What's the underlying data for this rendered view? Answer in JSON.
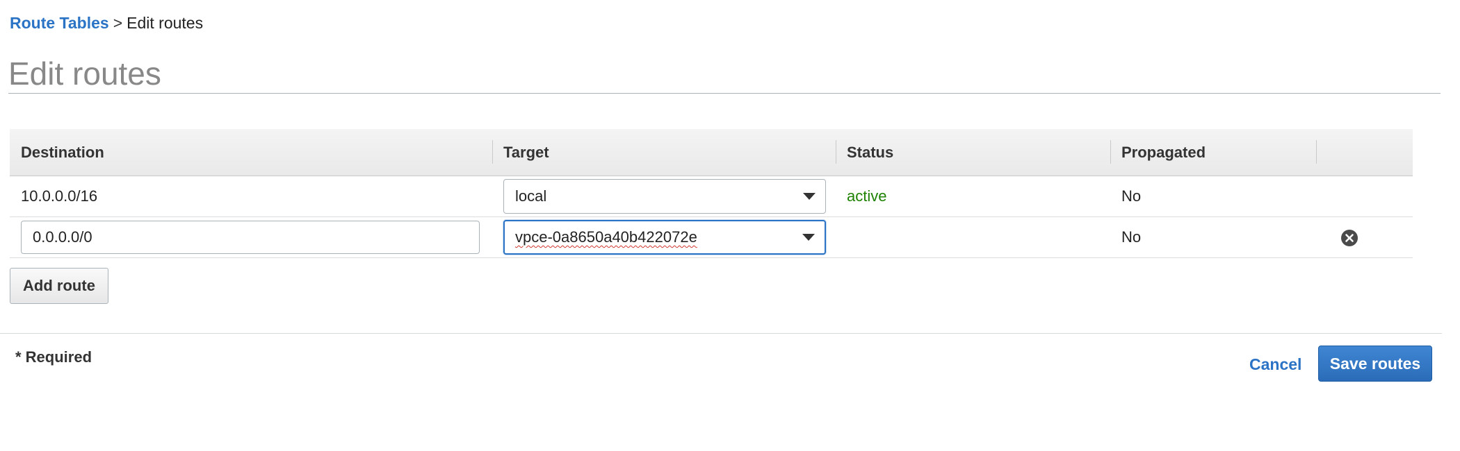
{
  "breadcrumb": {
    "parent": "Route Tables",
    "separator": ">",
    "current": "Edit routes"
  },
  "page_title": "Edit routes",
  "table": {
    "columns": [
      "Destination",
      "Target",
      "Status",
      "Propagated"
    ],
    "rows": [
      {
        "destination": "10.0.0.0/16",
        "target": "local",
        "status": "active",
        "propagated": "No",
        "editable": false
      },
      {
        "destination": "0.0.0.0/0",
        "target": "vpce-0a8650a40b422072e",
        "status": "",
        "propagated": "No",
        "editable": true
      }
    ]
  },
  "icons": {
    "remove_row": "close-circle-icon",
    "dropdown": "caret-down-icon"
  },
  "actions": {
    "add_route": "Add route",
    "cancel": "Cancel",
    "save": "Save routes"
  },
  "required_note": "* Required",
  "colors": {
    "link": "#2a73c5",
    "status_active": "#1d8102",
    "primary_button": "#2b6cb8",
    "title": "#888888"
  }
}
